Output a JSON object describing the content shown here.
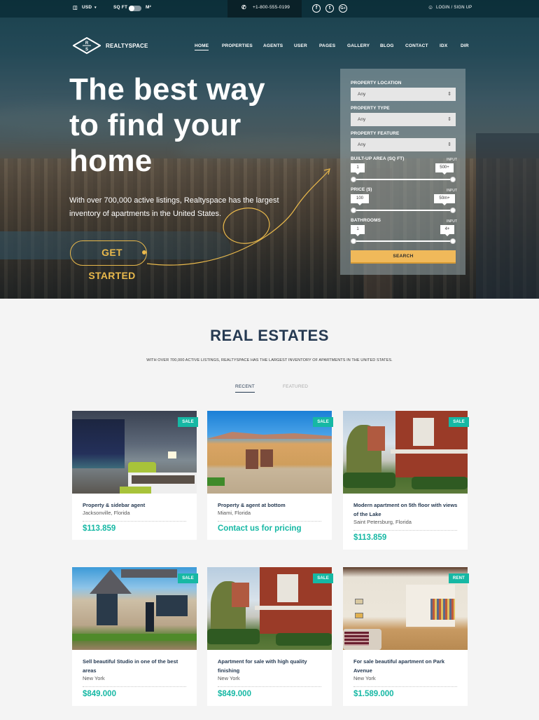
{
  "topbar": {
    "currency": "USD",
    "currency_caret": "▾",
    "unit_left": "SQ FT",
    "unit_right": "M²",
    "phone": "+1-800-555-0199",
    "social": [
      {
        "name": "facebook",
        "glyph": "f"
      },
      {
        "name": "twitter",
        "glyph": "t"
      },
      {
        "name": "google-plus",
        "glyph": "G+"
      }
    ],
    "login": "LOGIN / SIGN UP"
  },
  "brand": {
    "logo_top": "R",
    "logo_bottom": "S",
    "name": "REALTYSPACE"
  },
  "nav": [
    "HOME",
    "PROPERTIES",
    "AGENTS",
    "USER",
    "PAGES",
    "GALLERY",
    "BLOG",
    "CONTACT",
    "IDX",
    "DIR"
  ],
  "hero": {
    "title": "The best way to find your home",
    "subtitle": "With over 700,000 active listings, Realtyspace has the largest inventory of apartments in the United States.",
    "cta": "GET STARTED"
  },
  "search": {
    "location_label": "PROPERTY LOCATION",
    "location_value": "Any",
    "type_label": "PROPERTY TYPE",
    "type_value": "Any",
    "feature_label": "PROPERTY FEATURE",
    "feature_value": "Any",
    "area_label": "BUILT-UP AREA (SQ FT)",
    "area_min": "1",
    "area_max": "500+",
    "price_label": "PRICE ($)",
    "price_min": "100",
    "price_max": "50m+",
    "bath_label": "BATHROOMS",
    "bath_min": "1",
    "bath_max": "4+",
    "input_label": "INPUT",
    "button": "SEARCH"
  },
  "section": {
    "title": "REAL ESTATES",
    "subtitle": "WITH OVER 700,000 ACTIVE LISTINGS, REALTYSPACE HAS THE LARGEST INVENTORY OF APARTMENTS IN THE UNITED STATES.",
    "tabs": [
      {
        "label": "RECENT",
        "active": true
      },
      {
        "label": "FEATURED",
        "active": false
      }
    ]
  },
  "listings": [
    {
      "badge": "SALE",
      "title": "Property & sidebar agent",
      "location": "Jacksonville, Florida",
      "price": "$113.859",
      "image": "hotel-bedroom"
    },
    {
      "badge": "SALE",
      "title": "Property & agent at bottom",
      "location": "Miami, Florida",
      "price": "Contact us for pricing",
      "image": "stucco-villa"
    },
    {
      "badge": "SALE",
      "title": "Modern apartment on 5th floor with views of the Lake",
      "location": "Saint Petersburg, Florida",
      "price": "$113.859",
      "image": "victorian-house"
    },
    {
      "badge": "SALE",
      "title": "Sell beautiful Studio in one of the best areas",
      "location": "New York",
      "price": "$849.000",
      "image": "stone-house"
    },
    {
      "badge": "SALE",
      "title": "Apartment for sale with high quality finishing",
      "location": "New York",
      "price": "$849.000",
      "image": "victorian-house"
    },
    {
      "badge": "RENT",
      "title": "For sale beautiful apartment on Park Avenue",
      "location": "New York",
      "price": "$1.589.000",
      "image": "loft-interior"
    }
  ],
  "colors": {
    "accent": "#16b8a4",
    "cta": "#e9b94c",
    "search_button": "#f0b95a",
    "heading": "#263a52"
  }
}
